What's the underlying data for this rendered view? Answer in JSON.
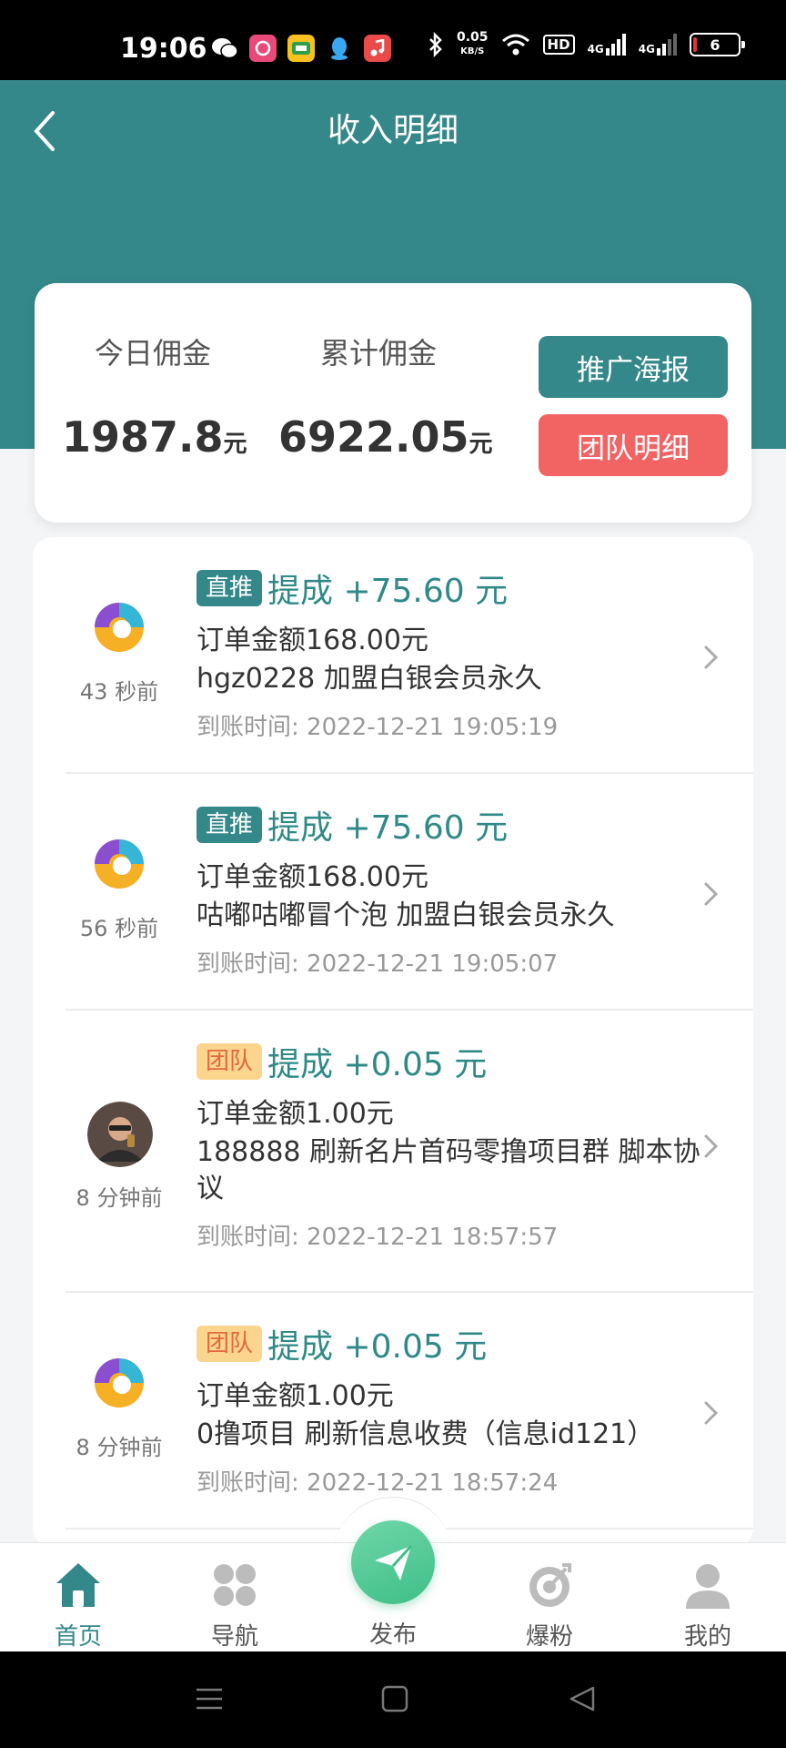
{
  "status_bar": {
    "time": "19:06",
    "net_speed_value": "0.05",
    "net_speed_unit": "KB/S",
    "hd_label": "HD",
    "network_1": "4G",
    "network_2": "4G",
    "battery": "6"
  },
  "header": {
    "title": "收入明细"
  },
  "summary": {
    "today_label": "今日佣金",
    "today_value": "1987.8",
    "today_unit": "元",
    "total_label": "累计佣金",
    "total_value": "6922.05",
    "total_unit": "元",
    "poster_button": "推广海报",
    "team_button": "团队明细"
  },
  "records": [
    {
      "ago": "43 秒前",
      "tag": "直推",
      "tag_type": "direct",
      "amount": "提成 +75.60 元",
      "order": "订单金额168.00元",
      "desc": "hgz0228 加盟白银会员永久",
      "time": "到账时间: 2022-12-21 19:05:19"
    },
    {
      "ago": "56 秒前",
      "tag": "直推",
      "tag_type": "direct",
      "amount": "提成 +75.60 元",
      "order": "订单金额168.00元",
      "desc": "咕嘟咕嘟冒个泡 加盟白银会员永久",
      "time": "到账时间: 2022-12-21 19:05:07"
    },
    {
      "ago": "8 分钟前",
      "tag": "团队",
      "tag_type": "team",
      "amount": "提成 +0.05 元",
      "order": "订单金额1.00元",
      "desc": "188888 刷新名片首码零撸项目群 脚本协议",
      "time": "到账时间: 2022-12-21 18:57:57"
    },
    {
      "ago": "8 分钟前",
      "tag": "团队",
      "tag_type": "team",
      "amount": "提成 +0.05 元",
      "order": "订单金额1.00元",
      "desc": "0撸项目 刷新信息收费（信息id121）",
      "time": "到账时间: 2022-12-21 18:57:24"
    }
  ],
  "tabbar": {
    "home": "首页",
    "nav": "导航",
    "publish": "发布",
    "fans": "爆粉",
    "mine": "我的"
  },
  "colors": {
    "primary": "#35888a",
    "danger": "#f26464",
    "team_tag_bg": "#fbd48e",
    "team_tag_text": "#e06a3c",
    "amount": "#2f8a87"
  }
}
